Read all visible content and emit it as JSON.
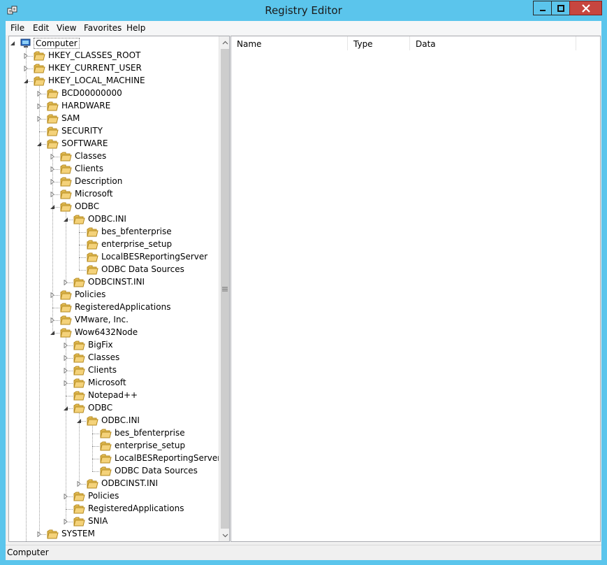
{
  "window": {
    "title": "Registry Editor"
  },
  "menu": [
    "File",
    "Edit",
    "View",
    "Favorites",
    "Help"
  ],
  "tree": [
    {
      "label": "Computer",
      "depth": 0,
      "state": "expanded",
      "icon": "computer-icon",
      "selected": true
    },
    {
      "label": "HKEY_CLASSES_ROOT",
      "depth": 1,
      "state": "collapsed"
    },
    {
      "label": "HKEY_CURRENT_USER",
      "depth": 1,
      "state": "collapsed"
    },
    {
      "label": "HKEY_LOCAL_MACHINE",
      "depth": 1,
      "state": "expanded"
    },
    {
      "label": "BCD00000000",
      "depth": 2,
      "state": "collapsed"
    },
    {
      "label": "HARDWARE",
      "depth": 2,
      "state": "collapsed"
    },
    {
      "label": "SAM",
      "depth": 2,
      "state": "collapsed"
    },
    {
      "label": "SECURITY",
      "depth": 2,
      "state": "leaf"
    },
    {
      "label": "SOFTWARE",
      "depth": 2,
      "state": "expanded"
    },
    {
      "label": "Classes",
      "depth": 3,
      "state": "collapsed"
    },
    {
      "label": "Clients",
      "depth": 3,
      "state": "collapsed"
    },
    {
      "label": "Description",
      "depth": 3,
      "state": "collapsed"
    },
    {
      "label": "Microsoft",
      "depth": 3,
      "state": "collapsed"
    },
    {
      "label": "ODBC",
      "depth": 3,
      "state": "expanded"
    },
    {
      "label": "ODBC.INI",
      "depth": 4,
      "state": "expanded"
    },
    {
      "label": "bes_bfenterprise",
      "depth": 5,
      "state": "leaf"
    },
    {
      "label": "enterprise_setup",
      "depth": 5,
      "state": "leaf"
    },
    {
      "label": "LocalBESReportingServer",
      "depth": 5,
      "state": "leaf"
    },
    {
      "label": "ODBC Data Sources",
      "depth": 5,
      "state": "leaf"
    },
    {
      "label": "ODBCINST.INI",
      "depth": 4,
      "state": "collapsed"
    },
    {
      "label": "Policies",
      "depth": 3,
      "state": "collapsed"
    },
    {
      "label": "RegisteredApplications",
      "depth": 3,
      "state": "leaf"
    },
    {
      "label": "VMware, Inc.",
      "depth": 3,
      "state": "collapsed"
    },
    {
      "label": "Wow6432Node",
      "depth": 3,
      "state": "expanded"
    },
    {
      "label": "BigFix",
      "depth": 4,
      "state": "collapsed"
    },
    {
      "label": "Classes",
      "depth": 4,
      "state": "collapsed"
    },
    {
      "label": "Clients",
      "depth": 4,
      "state": "collapsed"
    },
    {
      "label": "Microsoft",
      "depth": 4,
      "state": "collapsed"
    },
    {
      "label": "Notepad++",
      "depth": 4,
      "state": "leaf"
    },
    {
      "label": "ODBC",
      "depth": 4,
      "state": "expanded"
    },
    {
      "label": "ODBC.INI",
      "depth": 5,
      "state": "expanded"
    },
    {
      "label": "bes_bfenterprise",
      "depth": 6,
      "state": "leaf"
    },
    {
      "label": "enterprise_setup",
      "depth": 6,
      "state": "leaf"
    },
    {
      "label": "LocalBESReportingServer",
      "depth": 6,
      "state": "leaf"
    },
    {
      "label": "ODBC Data Sources",
      "depth": 6,
      "state": "leaf"
    },
    {
      "label": "ODBCINST.INI",
      "depth": 5,
      "state": "collapsed"
    },
    {
      "label": "Policies",
      "depth": 4,
      "state": "collapsed"
    },
    {
      "label": "RegisteredApplications",
      "depth": 4,
      "state": "leaf"
    },
    {
      "label": "SNIA",
      "depth": 4,
      "state": "collapsed"
    },
    {
      "label": "SYSTEM",
      "depth": 2,
      "state": "collapsed"
    }
  ],
  "list": {
    "columns": [
      "Name",
      "Type",
      "Data"
    ]
  },
  "status": {
    "path": "Computer"
  },
  "colors": {
    "titlebar": "#5bc5ec",
    "close_button": "#c7463f",
    "folder": "#e8c15a"
  }
}
